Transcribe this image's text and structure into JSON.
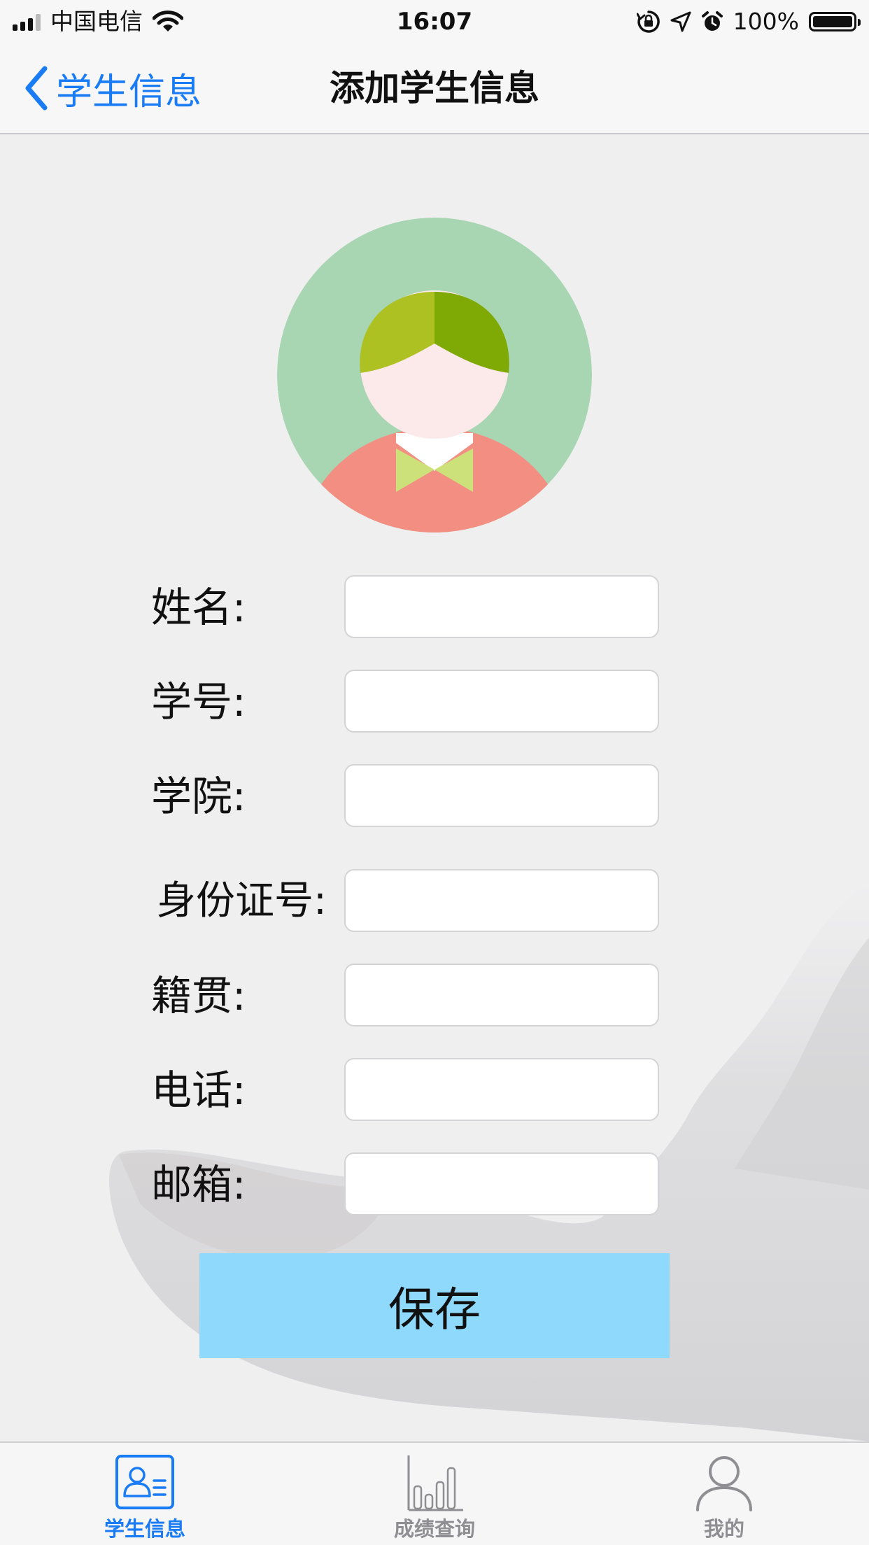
{
  "status_bar": {
    "carrier": "中国电信",
    "time": "16:07",
    "battery": "100%",
    "battery_level": 1.0
  },
  "nav": {
    "back_label": "学生信息",
    "title": "添加学生信息"
  },
  "avatar": {
    "icon": "student-avatar-icon",
    "colors": {
      "background": "#a8d5b2",
      "hair_left": "#adc123",
      "hair_right": "#7fa904",
      "face": "#fce9e9",
      "shirt": "#f28f82",
      "bow": "#cde17a"
    }
  },
  "form": {
    "fields": [
      {
        "label": "姓名:",
        "value": "",
        "placeholder": ""
      },
      {
        "label": "学号:",
        "value": "",
        "placeholder": ""
      },
      {
        "label": "学院:",
        "value": "",
        "placeholder": ""
      },
      {
        "label": "身份证号:",
        "value": "",
        "placeholder": ""
      },
      {
        "label": "籍贯:",
        "value": "",
        "placeholder": ""
      },
      {
        "label": "电话:",
        "value": "",
        "placeholder": ""
      },
      {
        "label": "邮箱:",
        "value": "",
        "placeholder": ""
      }
    ],
    "save_label": "保存"
  },
  "tabs": [
    {
      "label": "学生信息",
      "icon": "id-card-icon",
      "active": true
    },
    {
      "label": "成绩查询",
      "icon": "bar-chart-icon",
      "active": false
    },
    {
      "label": "我的",
      "icon": "person-icon",
      "active": false
    }
  ],
  "colors": {
    "accent": "#1a7cf5",
    "save_button": "#8ed9fc",
    "tab_inactive": "#8e8e93"
  }
}
